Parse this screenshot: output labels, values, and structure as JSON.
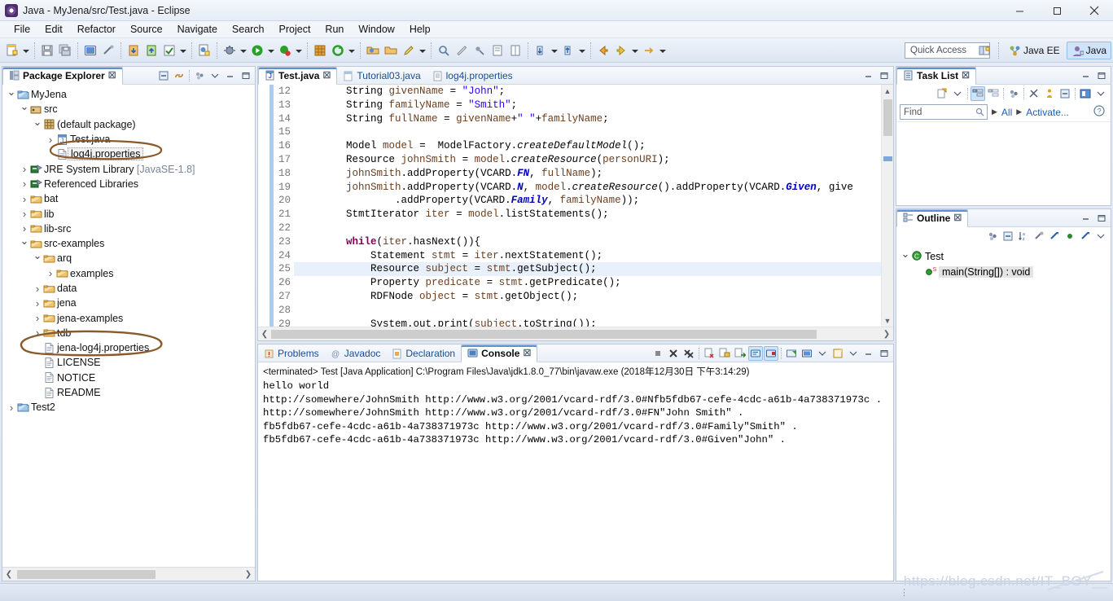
{
  "window": {
    "title": "Java - MyJena/src/Test.java - Eclipse",
    "app_icon": "eclipse-icon",
    "minimize": "minimize-button",
    "maximize": "maximize-button",
    "close": "close-button"
  },
  "menubar": {
    "items": [
      "File",
      "Edit",
      "Refactor",
      "Source",
      "Navigate",
      "Search",
      "Project",
      "Run",
      "Window",
      "Help"
    ]
  },
  "toolbar": {
    "quick_access_placeholder": "Quick Access",
    "perspectives": [
      {
        "label": "Java EE",
        "active": false
      },
      {
        "label": "Java",
        "active": true
      }
    ],
    "icons": [
      "new-wizard-icon",
      "save-icon",
      "save-all-icon",
      "console-icon",
      "link-icon",
      "import-icon",
      "export-icon",
      "check-icon",
      "new-java-class-icon",
      "debug-icon",
      "run-icon",
      "profile-icon",
      "new-package-icon",
      "refresh-icon",
      "open-type-icon",
      "open-task-icon",
      "pencil-icon",
      "search-icon",
      "ruler-icon",
      "pin-icon",
      "toggle-block-icon",
      "toggle-mark-icon",
      "next-annotation-icon",
      "prev-annotation-icon",
      "back-icon",
      "forward-icon",
      "go-icon"
    ]
  },
  "package_explorer": {
    "tab_label": "Package Explorer",
    "tab_icon": "package-explorer-icon",
    "toolbar_icons": [
      "collapse-all-icon",
      "link-with-editor-icon",
      "view-menu-icon",
      "minimize-icon",
      "maximize-icon"
    ],
    "tree": [
      {
        "label": "MyJena",
        "indent": 0,
        "twist": "open",
        "icon": "project-icon"
      },
      {
        "label": "src",
        "indent": 1,
        "twist": "open",
        "icon": "source-folder-icon"
      },
      {
        "label": "(default package)",
        "indent": 2,
        "twist": "open",
        "icon": "package-icon"
      },
      {
        "label": "Test.java",
        "indent": 3,
        "twist": "closed",
        "icon": "java-file-icon"
      },
      {
        "label": "log4j.properties",
        "indent": 3,
        "twist": "none",
        "icon": "file-icon",
        "selected": true,
        "circled": true
      },
      {
        "label": "JRE System Library",
        "indent": 1,
        "twist": "closed",
        "icon": "library-icon",
        "suffix": "[JavaSE-1.8]"
      },
      {
        "label": "Referenced Libraries",
        "indent": 1,
        "twist": "closed",
        "icon": "library-icon"
      },
      {
        "label": "bat",
        "indent": 1,
        "twist": "closed",
        "icon": "folder-icon"
      },
      {
        "label": "lib",
        "indent": 1,
        "twist": "closed",
        "icon": "folder-icon"
      },
      {
        "label": "lib-src",
        "indent": 1,
        "twist": "closed",
        "icon": "folder-icon"
      },
      {
        "label": "src-examples",
        "indent": 1,
        "twist": "open",
        "icon": "folder-icon"
      },
      {
        "label": "arq",
        "indent": 2,
        "twist": "open",
        "icon": "folder-icon"
      },
      {
        "label": "examples",
        "indent": 3,
        "twist": "closed",
        "icon": "folder-icon"
      },
      {
        "label": "data",
        "indent": 2,
        "twist": "closed",
        "icon": "folder-icon"
      },
      {
        "label": "jena",
        "indent": 2,
        "twist": "closed",
        "icon": "folder-icon"
      },
      {
        "label": "jena-examples",
        "indent": 2,
        "twist": "closed",
        "icon": "folder-icon"
      },
      {
        "label": "tdb",
        "indent": 2,
        "twist": "closed",
        "icon": "folder-icon"
      },
      {
        "label": "jena-log4j.properties",
        "indent": 2,
        "twist": "none",
        "icon": "file-icon",
        "circled": true
      },
      {
        "label": "LICENSE",
        "indent": 2,
        "twist": "none",
        "icon": "file-icon"
      },
      {
        "label": "NOTICE",
        "indent": 2,
        "twist": "none",
        "icon": "file-icon"
      },
      {
        "label": "README",
        "indent": 2,
        "twist": "none",
        "icon": "file-icon"
      },
      {
        "label": "Test2",
        "indent": 0,
        "twist": "closed",
        "icon": "project-icon"
      }
    ]
  },
  "editor": {
    "tabs": [
      {
        "label": "Test.java",
        "icon": "java-file-icon",
        "active": true,
        "closable": true
      },
      {
        "label": "Tutorial03.java",
        "icon": "java-file-icon",
        "active": false,
        "closable": false
      },
      {
        "label": "log4j.properties",
        "icon": "file-icon",
        "active": false,
        "closable": false
      }
    ],
    "first_line_number": 12,
    "current_line": 25,
    "lines": [
      {
        "n": 12,
        "text": "        String givenName = \"John\";"
      },
      {
        "n": 13,
        "text": "        String familyName = \"Smith\";"
      },
      {
        "n": 14,
        "text": "        String fullName = givenName+\" \"+familyName;"
      },
      {
        "n": 15,
        "text": ""
      },
      {
        "n": 16,
        "text": "        Model model =  ModelFactory.createDefaultModel();"
      },
      {
        "n": 17,
        "text": "        Resource johnSmith = model.createResource(personURI);"
      },
      {
        "n": 18,
        "text": "        johnSmith.addProperty(VCARD.FN, fullName);"
      },
      {
        "n": 19,
        "text": "        johnSmith.addProperty(VCARD.N, model.createResource().addProperty(VCARD.Given, give"
      },
      {
        "n": 20,
        "text": "                .addProperty(VCARD.Family, familyName));"
      },
      {
        "n": 21,
        "text": "        StmtIterator iter = model.listStatements();"
      },
      {
        "n": 22,
        "text": ""
      },
      {
        "n": 23,
        "text": "        while(iter.hasNext()){"
      },
      {
        "n": 24,
        "text": "            Statement stmt = iter.nextStatement();"
      },
      {
        "n": 25,
        "text": "            Resource subject = stmt.getSubject();"
      },
      {
        "n": 26,
        "text": "            Property predicate = stmt.getPredicate();"
      },
      {
        "n": 27,
        "text": "            RDFNode object = stmt.getObject();"
      },
      {
        "n": 28,
        "text": ""
      },
      {
        "n": 29,
        "text": "            System.out.print(subject.toString());"
      }
    ]
  },
  "bottom_panel": {
    "tabs": [
      {
        "label": "Problems",
        "icon": "problems-icon",
        "active": false
      },
      {
        "label": "Javadoc",
        "icon": "javadoc-icon",
        "active": false
      },
      {
        "label": "Declaration",
        "icon": "declaration-icon",
        "active": false
      },
      {
        "label": "Console",
        "icon": "console-icon",
        "active": true,
        "closable": true
      }
    ],
    "toolbar_icons": [
      "terminate-icon",
      "remove-launch-icon",
      "remove-all-launches-icon",
      "clear-console-icon",
      "scroll-lock-icon",
      "show-console-on-output-icon",
      "pin-console-icon",
      "display-selected-console-icon",
      "open-console-icon",
      "new-console-view-icon",
      "view-menu-icon",
      "minimize-icon",
      "maximize-icon"
    ],
    "console": {
      "header": "<terminated> Test [Java Application] C:\\Program Files\\Java\\jdk1.8.0_77\\bin\\javaw.exe (2018年12月30日 下午3:14:29)",
      "lines": [
        "hello world",
        "http://somewhere/JohnSmith http://www.w3.org/2001/vcard-rdf/3.0#Nfb5fdb67-cefe-4cdc-a61b-4a738371973c .",
        "http://somewhere/JohnSmith http://www.w3.org/2001/vcard-rdf/3.0#FN\"John Smith\" .",
        "fb5fdb67-cefe-4cdc-a61b-4a738371973c http://www.w3.org/2001/vcard-rdf/3.0#Family\"Smith\" .",
        "fb5fdb67-cefe-4cdc-a61b-4a738371973c http://www.w3.org/2001/vcard-rdf/3.0#Given\"John\" ."
      ]
    }
  },
  "task_list": {
    "tab_label": "Task List",
    "tab_icon": "task-list-icon",
    "toolbar_icons": [
      "new-task-icon",
      "new-task-menu-icon",
      "categorized-mode-icon",
      "scheduled-mode-icon",
      "synchronize-icon",
      "focus-on-workweek-icon",
      "show-ui-legend-icon",
      "collapse-all-icon",
      "restore-tasks-icon",
      "view-menu-icon"
    ],
    "find_placeholder": "Find",
    "filter_all": "All",
    "filter_activate": "Activate...",
    "help_icon": "help-icon",
    "minimize_icon": "minimize-icon",
    "maximize_icon": "maximize-icon"
  },
  "outline": {
    "tab_label": "Outline",
    "tab_icon": "outline-icon",
    "toolbar_icons": [
      "focus-on-active-task-icon",
      "hide-fields-icon",
      "sort-icon",
      "hide-static-icon",
      "hide-non-public-icon",
      "hide-local-types-icon",
      "hide-fields-2-icon",
      "view-menu-icon"
    ],
    "tree": [
      {
        "label": "Test",
        "indent": 0,
        "twist": "open",
        "icon": "class-icon"
      },
      {
        "label": "main(String[]) : void",
        "indent": 1,
        "twist": "none",
        "icon": "public-static-method-icon",
        "selected": true
      }
    ]
  },
  "status_bar": {
    "grip": "resize-grip"
  },
  "watermark": {
    "text": "https://blog.csdn.net/IT_BOY__"
  },
  "colors": {
    "accent": "#2a5db0",
    "annotation": "#8a5a2b",
    "keyword": "#7f0055",
    "string": "#2a00ff",
    "static_field": "#0000c0",
    "local_var": "#6a3e1f",
    "current_line": "#e8f1fb"
  }
}
